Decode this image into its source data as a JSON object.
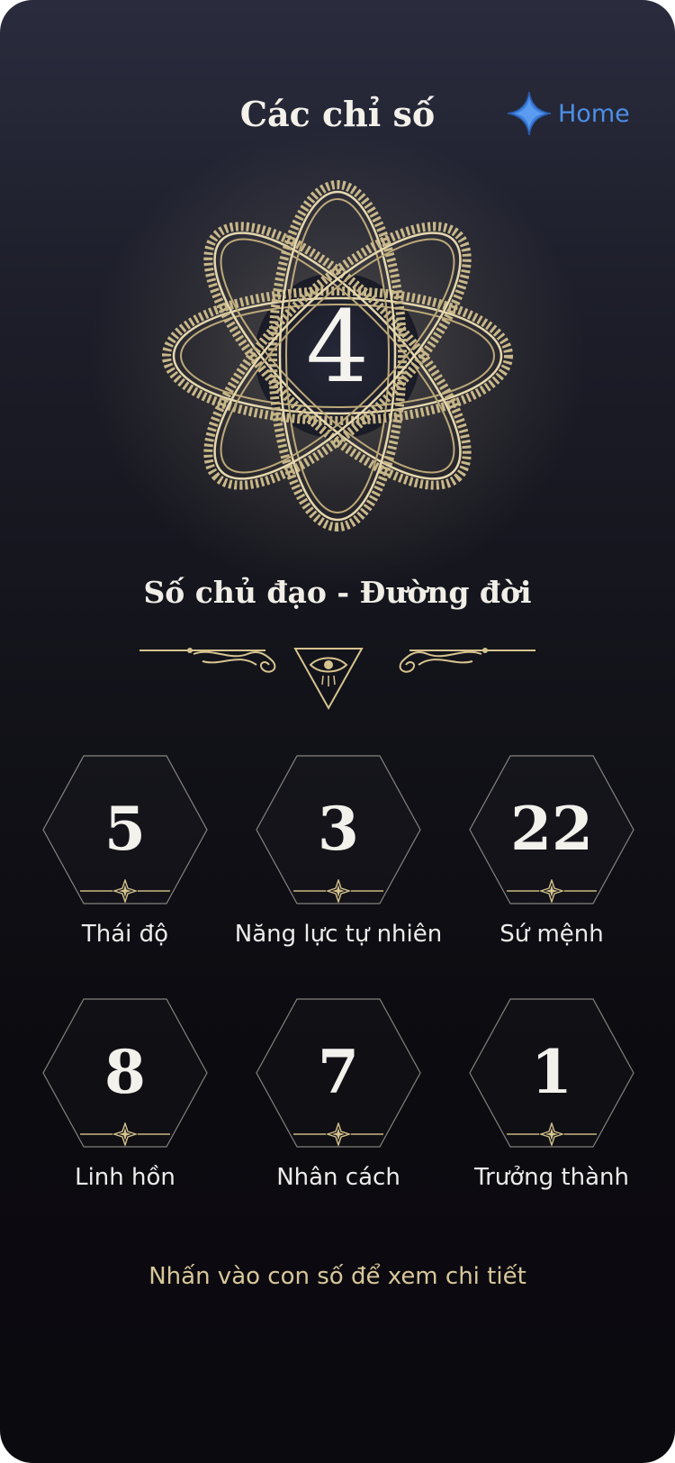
{
  "header": {
    "title": "Các chỉ số",
    "home_label": "Home"
  },
  "main": {
    "number": "4",
    "caption": "Số chủ đạo - Đường đời"
  },
  "indices": [
    {
      "number": "5",
      "label": "Thái độ"
    },
    {
      "number": "3",
      "label": "Năng lực tự nhiên"
    },
    {
      "number": "22",
      "label": "Sứ mệnh"
    },
    {
      "number": "8",
      "label": "Linh hồn"
    },
    {
      "number": "7",
      "label": "Nhân cách"
    },
    {
      "number": "1",
      "label": "Trưởng thành"
    }
  ],
  "hint": "Nhấn vào con số để xem chi tiết",
  "colors": {
    "accent_gold": "#d8c79a",
    "link_blue": "#4c8fe6",
    "background_top": "#2a2c3e",
    "background_bottom": "#0b0a0f"
  },
  "icons": {
    "home": "sparkle-star-icon",
    "divider_center": "eye-of-providence-icon",
    "card_separator": "compass-star-icon"
  }
}
